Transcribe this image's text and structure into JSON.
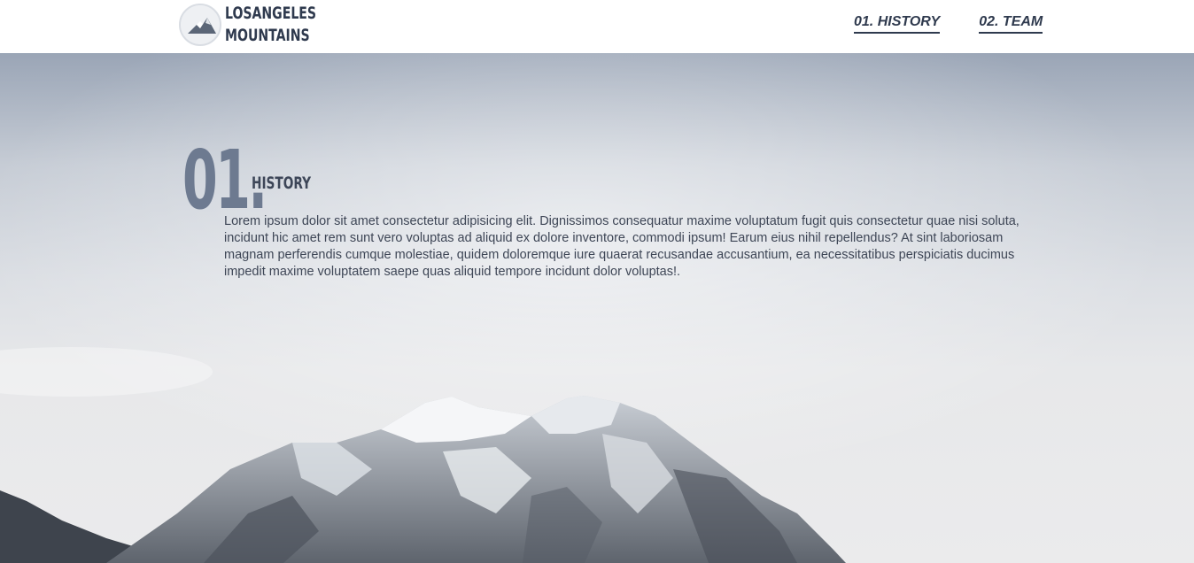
{
  "header": {
    "logo": {
      "line1": "LOSANGELES",
      "line2": "MOUNTAINS",
      "icon": "mountain-logo-icon"
    },
    "nav": [
      {
        "label": "01. HISTORY"
      },
      {
        "label": "02. TEAM"
      }
    ]
  },
  "hero": {
    "section_number": "01.",
    "section_title": "HISTORY",
    "body": "Lorem ipsum dolor sit amet consectetur adipisicing elit. Dignissimos consequatur maxime voluptatum fugit quis consectetur quae nisi soluta, incidunt hic amet rem sunt vero voluptas ad aliquid ex dolore inventore, commodi ipsum! Earum eius nihil repellendus? At sint laboriosam magnam perferendis cumque molestiae, quidem doloremque iure quaerat recusandae accusantium, ea necessitatibus perspiciatis ducimus impedit maxime voluptatem saepe quas aliquid tempore incidunt dolor voluptas!.",
    "background": "snowy-mountain-photo"
  },
  "colors": {
    "brand_text": "#2f3a4e",
    "section_number": "#6d7a90",
    "body_text": "#3e4656"
  }
}
